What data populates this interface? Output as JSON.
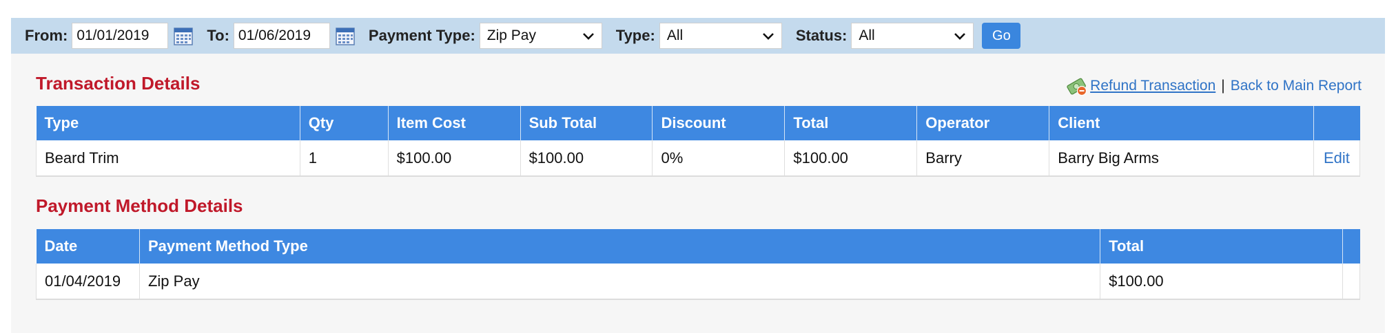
{
  "filters": {
    "from_label": "From:",
    "from_value": "01/01/2019",
    "to_label": "To:",
    "to_value": "01/06/2019",
    "payment_type_label": "Payment Type:",
    "payment_type_value": "Zip Pay",
    "type_label": "Type:",
    "type_value": "All",
    "status_label": "Status:",
    "status_value": "All",
    "go_label": "Go"
  },
  "transaction": {
    "title": "Transaction Details",
    "refund_label": "Refund Transaction",
    "separator": "|",
    "back_label": "Back to Main Report",
    "headers": [
      "Type",
      "Qty",
      "Item Cost",
      "Sub Total",
      "Discount",
      "Total",
      "Operator",
      "Client",
      ""
    ],
    "rows": [
      [
        "Beard Trim",
        "1",
        "$100.00",
        "$100.00",
        "0%",
        "$100.00",
        "Barry",
        "Barry Big Arms",
        "Edit"
      ]
    ]
  },
  "payment": {
    "title": "Payment Method Details",
    "headers": [
      "Date",
      "Payment Method Type",
      "Total",
      ""
    ],
    "rows": [
      [
        "01/04/2019",
        "Zip Pay",
        "$100.00",
        ""
      ]
    ]
  },
  "colors": {
    "filterbar_bg": "#c4daed",
    "header_blue": "#3e88e1",
    "title_red": "#c0192a",
    "link_blue": "#2f73c6"
  },
  "icons": [
    "calendar-icon",
    "chevron-down-icon",
    "refund-money-icon"
  ]
}
